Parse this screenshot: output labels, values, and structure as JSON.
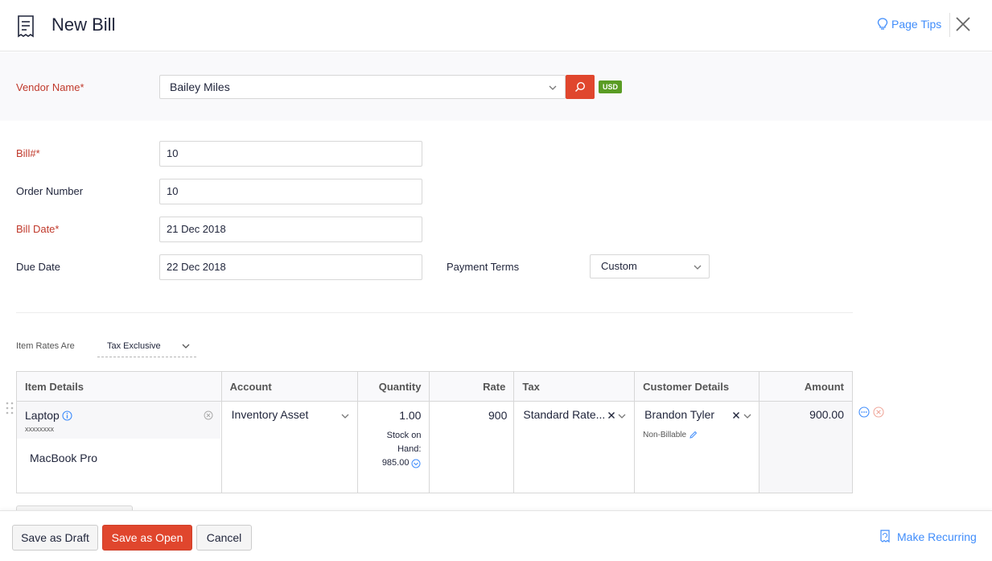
{
  "header": {
    "title": "New Bill",
    "page_tips": "Page Tips"
  },
  "vendor": {
    "label": "Vendor Name*",
    "value": "Bailey Miles",
    "currency": "USD"
  },
  "form": {
    "bill_label": "Bill#*",
    "bill_value": "10",
    "order_label": "Order Number",
    "order_value": "10",
    "bill_date_label": "Bill Date*",
    "bill_date_value": "21 Dec 2018",
    "due_date_label": "Due Date",
    "due_date_value": "22 Dec 2018",
    "payment_terms_label": "Payment Terms",
    "payment_terms_value": "Custom"
  },
  "rates": {
    "label": "Item Rates Are",
    "value": "Tax Exclusive"
  },
  "table": {
    "headers": {
      "item_details": "Item Details",
      "account": "Account",
      "quantity": "Quantity",
      "rate": "Rate",
      "tax": "Tax",
      "customer_details": "Customer Details",
      "amount": "Amount"
    },
    "row": {
      "item_name": "Laptop",
      "item_sku": "xxxxxxxx",
      "item_description": "MacBook Pro",
      "account": "Inventory Asset",
      "quantity": "1.00",
      "stock_label_1": "Stock on",
      "stock_label_2": "Hand:",
      "stock_value": "985.00",
      "rate": "900",
      "tax": "Standard Rate...",
      "customer": "Brandon Tyler",
      "billable": "Non-Billable",
      "amount": "900.00"
    }
  },
  "footer": {
    "save_draft": "Save as Draft",
    "save_open": "Save as Open",
    "cancel": "Cancel",
    "make_recurring": "Make Recurring"
  },
  "colors": {
    "accent": "#e0462d",
    "link": "#408dfb",
    "required": "#c0392b",
    "currency_badge": "#5a9c24"
  }
}
